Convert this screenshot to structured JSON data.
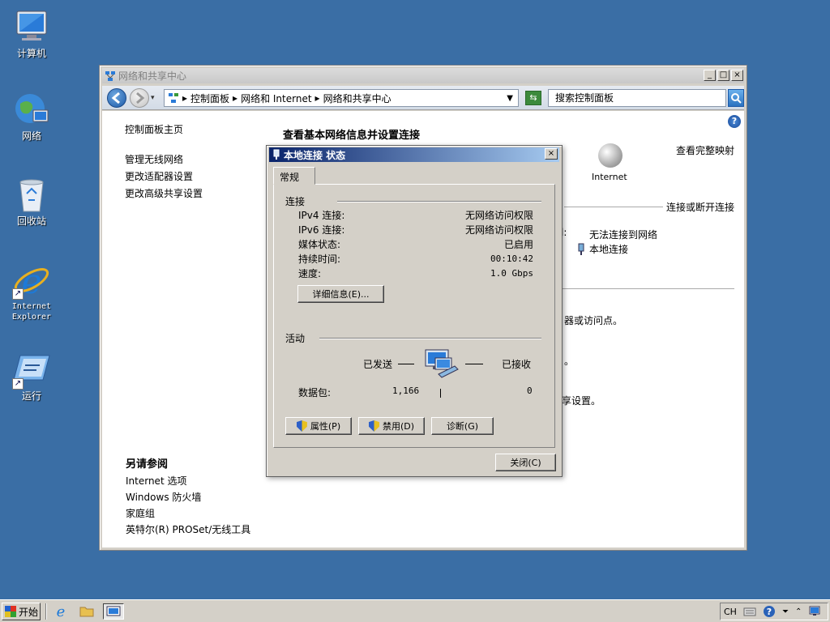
{
  "desktop": {
    "icons": [
      {
        "label": "计算机"
      },
      {
        "label": "网络"
      },
      {
        "label": "回收站"
      },
      {
        "label": "Internet Explorer"
      },
      {
        "label": "运行"
      }
    ]
  },
  "window": {
    "title": "网络和共享中心",
    "controls": {
      "minimize": "_",
      "maximize": "□",
      "close": "×"
    },
    "address": {
      "crumbs": [
        "控制面板",
        "网络和 Internet",
        "网络和共享中心"
      ]
    },
    "search_placeholder": "搜索控制面板",
    "left_nav": {
      "home": "控制面板主页",
      "items": [
        "管理无线网络",
        "更改适配器设置",
        "更改高级共享设置"
      ]
    },
    "main_title": "查看基本网络信息并设置连接",
    "full_map": "查看完整映射",
    "internet_label": "Internet",
    "connect_disconnect": "连接或断开连接",
    "fragments": {
      "colon": "l:",
      "no_connect": "无法连接到网络",
      "local_conn": "本地连接",
      "frag1": "器或访问点。",
      "frag2": "。",
      "frag3": "享设置。"
    },
    "see_also": {
      "header": "另请参阅",
      "items": [
        "Internet 选项",
        "Windows 防火墙",
        "家庭组",
        "英特尔(R) PROSet/无线工具"
      ]
    }
  },
  "dialog": {
    "title": "本地连接 状态",
    "close": "×",
    "tab": "常规",
    "connection": {
      "header": "连接",
      "rows": [
        {
          "label": "IPv4 连接:",
          "value": "无网络访问权限"
        },
        {
          "label": "IPv6 连接:",
          "value": "无网络访问权限"
        },
        {
          "label": "媒体状态:",
          "value": "已启用"
        },
        {
          "label": "持续时间:",
          "value": "00:10:42"
        },
        {
          "label": "速度:",
          "value": "1.0 Gbps"
        }
      ],
      "details_button": "详细信息(E)..."
    },
    "activity": {
      "header": "活动",
      "sent_label": "已发送",
      "received_label": "已接收",
      "packets_label": "数据包:",
      "sent_value": "1,166",
      "received_value": "0"
    },
    "buttons": {
      "properties": "属性(P)",
      "disable": "禁用(D)",
      "diagnose": "诊断(G)",
      "close": "关闭(C)"
    }
  },
  "taskbar": {
    "start": "开始",
    "lang": "CH"
  }
}
